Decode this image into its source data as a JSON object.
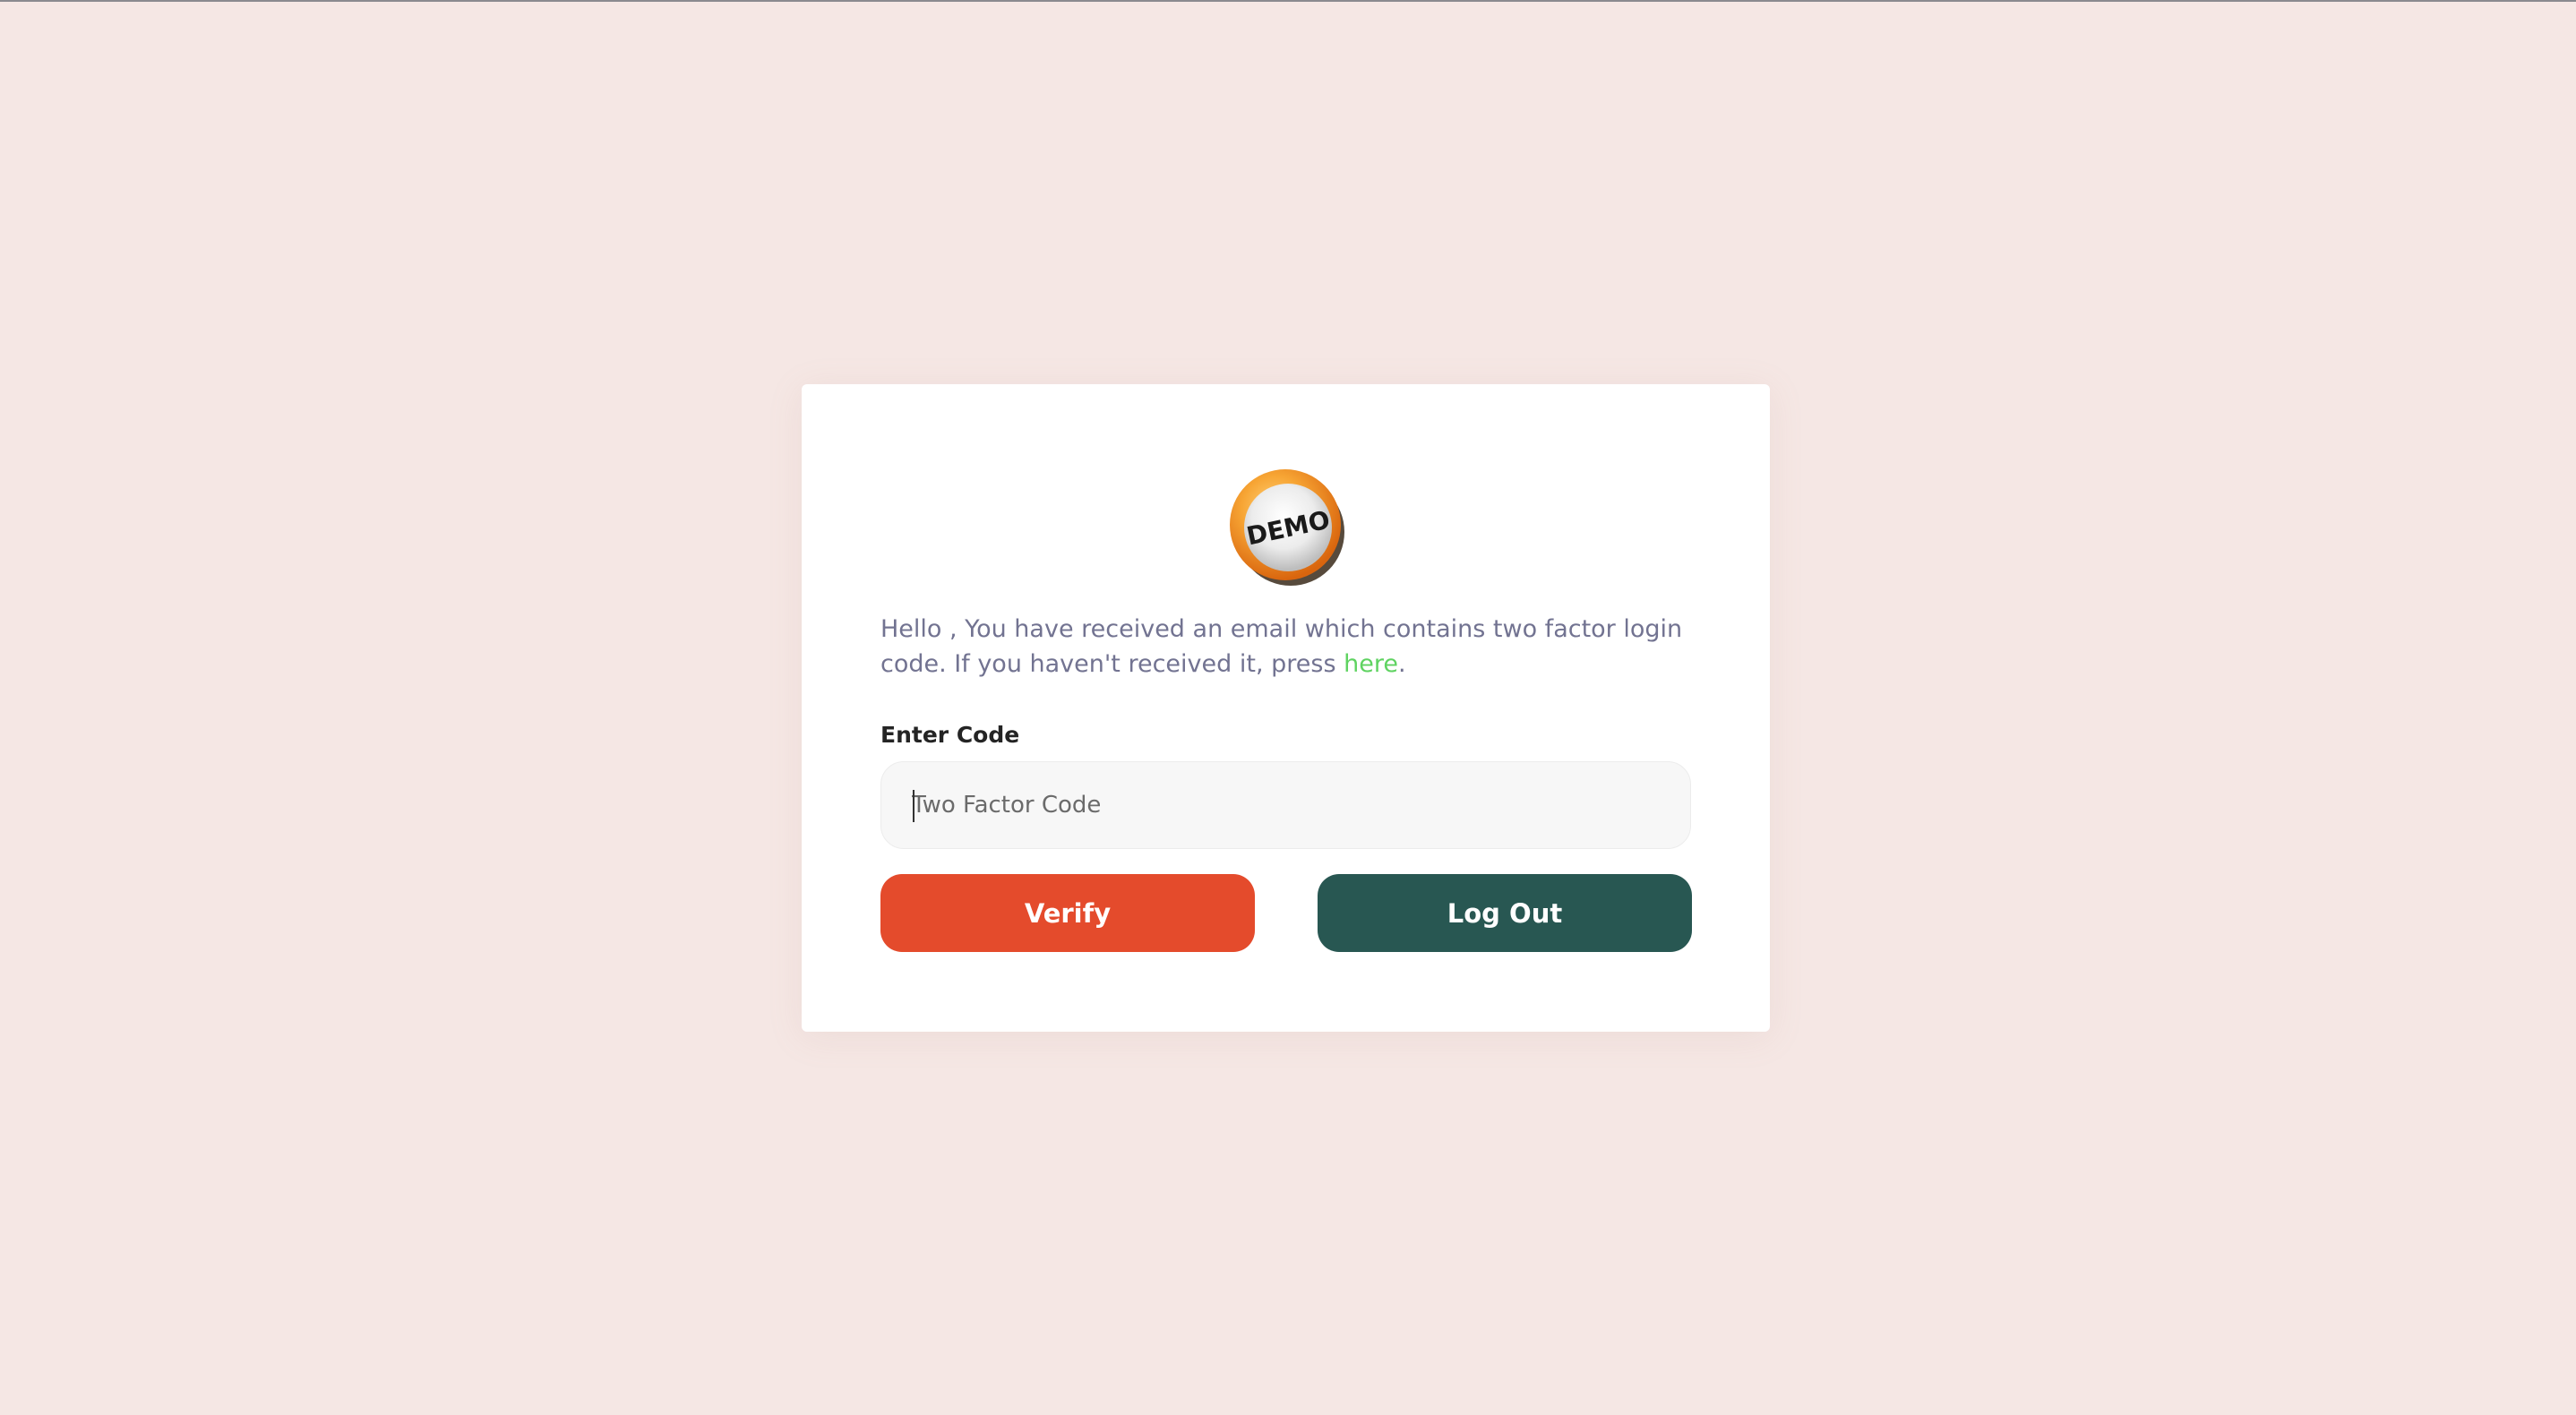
{
  "twofactor": {
    "logo_text": "DEMO",
    "message_prefix": "Hello , You have received an email which contains two factor login code. If you haven't received it, press ",
    "resend_link": "here",
    "message_suffix": ".",
    "code_label": "Enter Code",
    "code_value": "",
    "code_placeholder": "Two Factor Code",
    "verify_label": "Verify",
    "logout_label": "Log Out"
  },
  "colors": {
    "background": "#f5e7e4",
    "card": "#ffffff",
    "message_text": "#727391",
    "link": "#5fd361",
    "verify_button": "#e44b2c",
    "logout_button": "#285752",
    "logo_ring": "#f08a1c"
  }
}
